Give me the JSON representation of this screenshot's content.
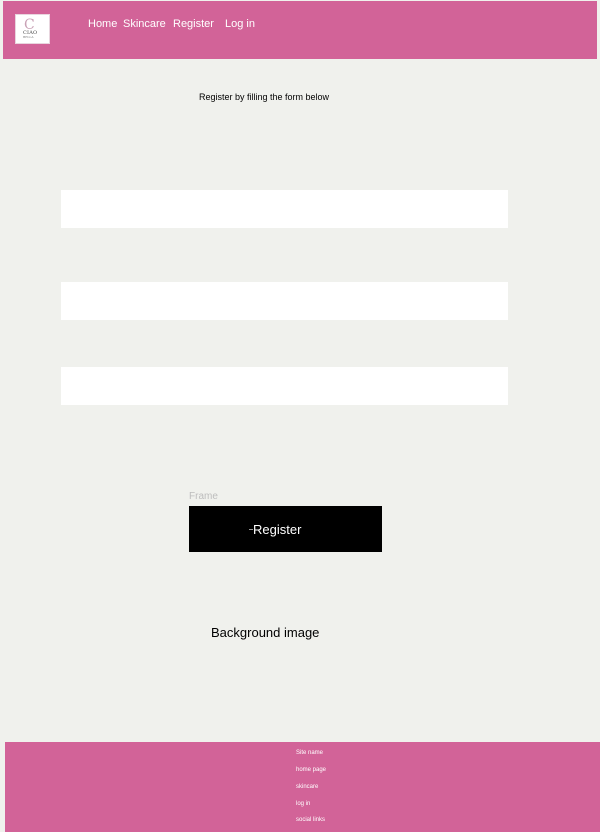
{
  "header": {
    "logo": {
      "mark": "C",
      "line1": "CIAO",
      "line2": "BELLA"
    },
    "nav": [
      "Home",
      "Skincare",
      "Register",
      "Log in"
    ]
  },
  "main": {
    "intro": "Register by filling the form below",
    "fields": [
      {
        "value": "",
        "placeholder": ""
      },
      {
        "value": "",
        "placeholder": ""
      },
      {
        "value": "",
        "placeholder": ""
      }
    ],
    "frame_label": "Frame",
    "register_button": "Register",
    "background_text": "Background image"
  },
  "footer": {
    "items": [
      "Site name",
      "home page",
      "skincare",
      "log in",
      "social links"
    ]
  },
  "colors": {
    "brand": "#d26398",
    "background": "#f0f1ed",
    "button": "#000000",
    "field": "#ffffff"
  }
}
